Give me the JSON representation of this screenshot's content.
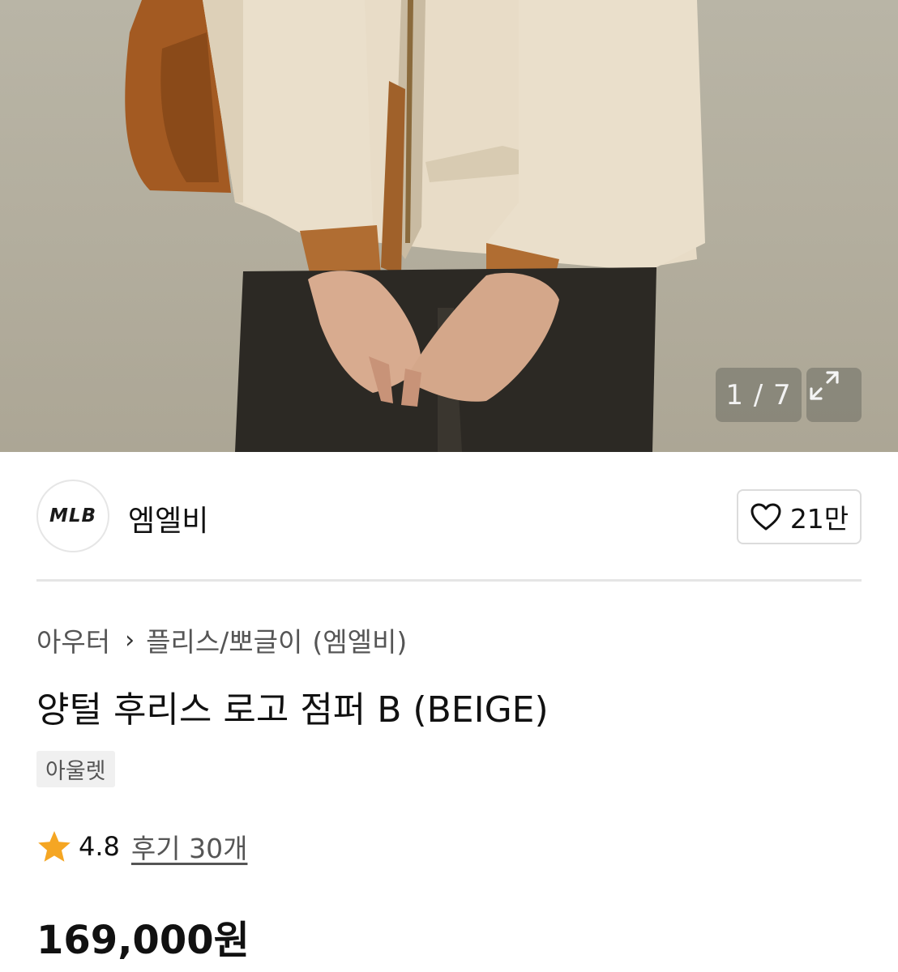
{
  "gallery": {
    "counter": "1 / 7",
    "expand_icon": "expand-icon"
  },
  "brand": {
    "logo_text": "MLB",
    "name": "엠엘비",
    "like_icon": "heart-outline-icon",
    "like_count": "21만"
  },
  "breadcrumb": {
    "category": "아우터",
    "separator_icon": "chevron-right-icon",
    "subcategory": "플리스/뽀글이",
    "brand": "(엠엘비)"
  },
  "product": {
    "title": "양털 후리스 로고 점퍼 B (BEIGE)",
    "tag": "아울렛",
    "rating_icon": "star-icon",
    "rating": "4.8",
    "reviews": "후기 30개",
    "price": "169,000원"
  },
  "colors": {
    "star": "#f5a623",
    "text": "#111111",
    "muted": "#555555",
    "border": "#dcdcdc"
  }
}
